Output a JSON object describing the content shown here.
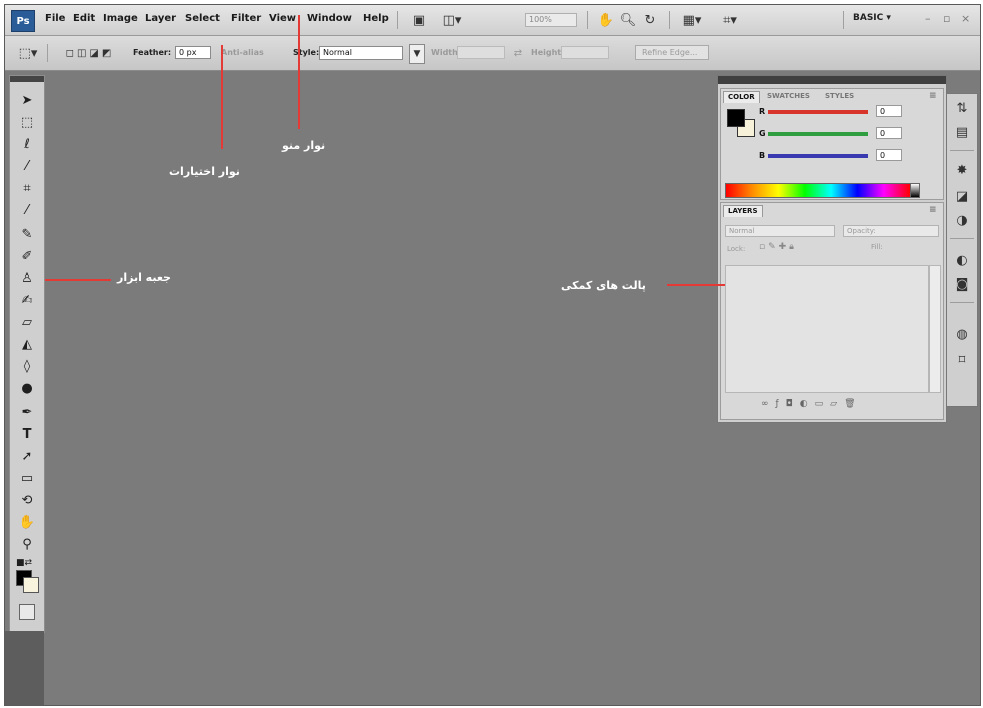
{
  "app": {
    "logo": "Ps"
  },
  "menubar": {
    "items": [
      "File",
      "Edit",
      "Image",
      "Layer",
      "Select",
      "Filter",
      "View",
      "Window",
      "Help"
    ],
    "zoom": "100%",
    "workspace": "BASIC ▾",
    "window_controls": [
      "–",
      "▫",
      "×"
    ]
  },
  "options_bar": {
    "feather_label": "Feather:",
    "feather_value": "0 px",
    "antialias_label": "Anti-alias",
    "style_label": "Style:",
    "style_value": "Normal",
    "width_label": "Width:",
    "height_label": "Height:",
    "refine_edge": "Refine Edge..."
  },
  "color_panel": {
    "tabs": [
      "COLOR",
      "SWATCHES",
      "STYLES"
    ],
    "channels": [
      {
        "label": "R",
        "value": "0",
        "color": "#d9342b"
      },
      {
        "label": "G",
        "value": "0",
        "color": "#2e9e3e"
      },
      {
        "label": "B",
        "value": "0",
        "color": "#3a3ab0"
      }
    ]
  },
  "layers_panel": {
    "tab": "LAYERS",
    "blend_mode": "Normal",
    "opacity_label": "Opacity:",
    "lock_label": "Lock:",
    "fill_label": "Fill:"
  },
  "annotations": {
    "menu_bar": "نوار منو",
    "options_bar": "نوار اختیارات",
    "toolbox": "جعبه ابزار",
    "panels": "پالت های کمکی"
  }
}
